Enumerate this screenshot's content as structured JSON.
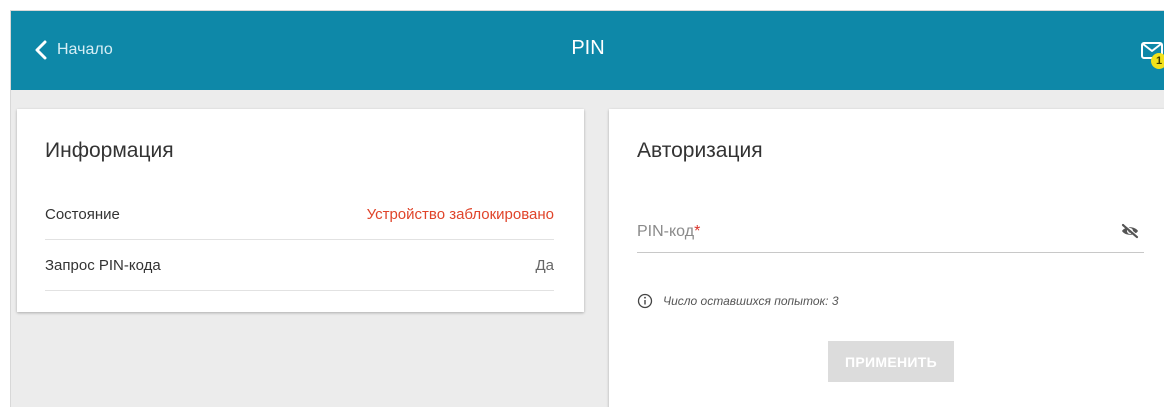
{
  "header": {
    "back_label": "Начало",
    "title": "PIN",
    "notifications_count": "1"
  },
  "info": {
    "title": "Информация",
    "rows": [
      {
        "label": "Состояние",
        "value": "Устройство заблокировано"
      },
      {
        "label": "Запрос PIN-кода",
        "value": "Да"
      }
    ]
  },
  "auth": {
    "title": "Авторизация",
    "pin_label": "PIN-код",
    "required_mark": "*",
    "pin_value": "",
    "hint": "Число оставшихся попыток: 3",
    "apply_label": "ПРИМЕНИТЬ"
  },
  "colors": {
    "header_bg": "#0e88a8",
    "alert": "#e0442a",
    "badge": "#f2e11b",
    "button_disabled": "#dcdcdc"
  },
  "icons": {
    "back": "chevron-left-icon",
    "mail": "envelope-icon",
    "eye": "eye-off-icon",
    "hint": "info-icon"
  }
}
